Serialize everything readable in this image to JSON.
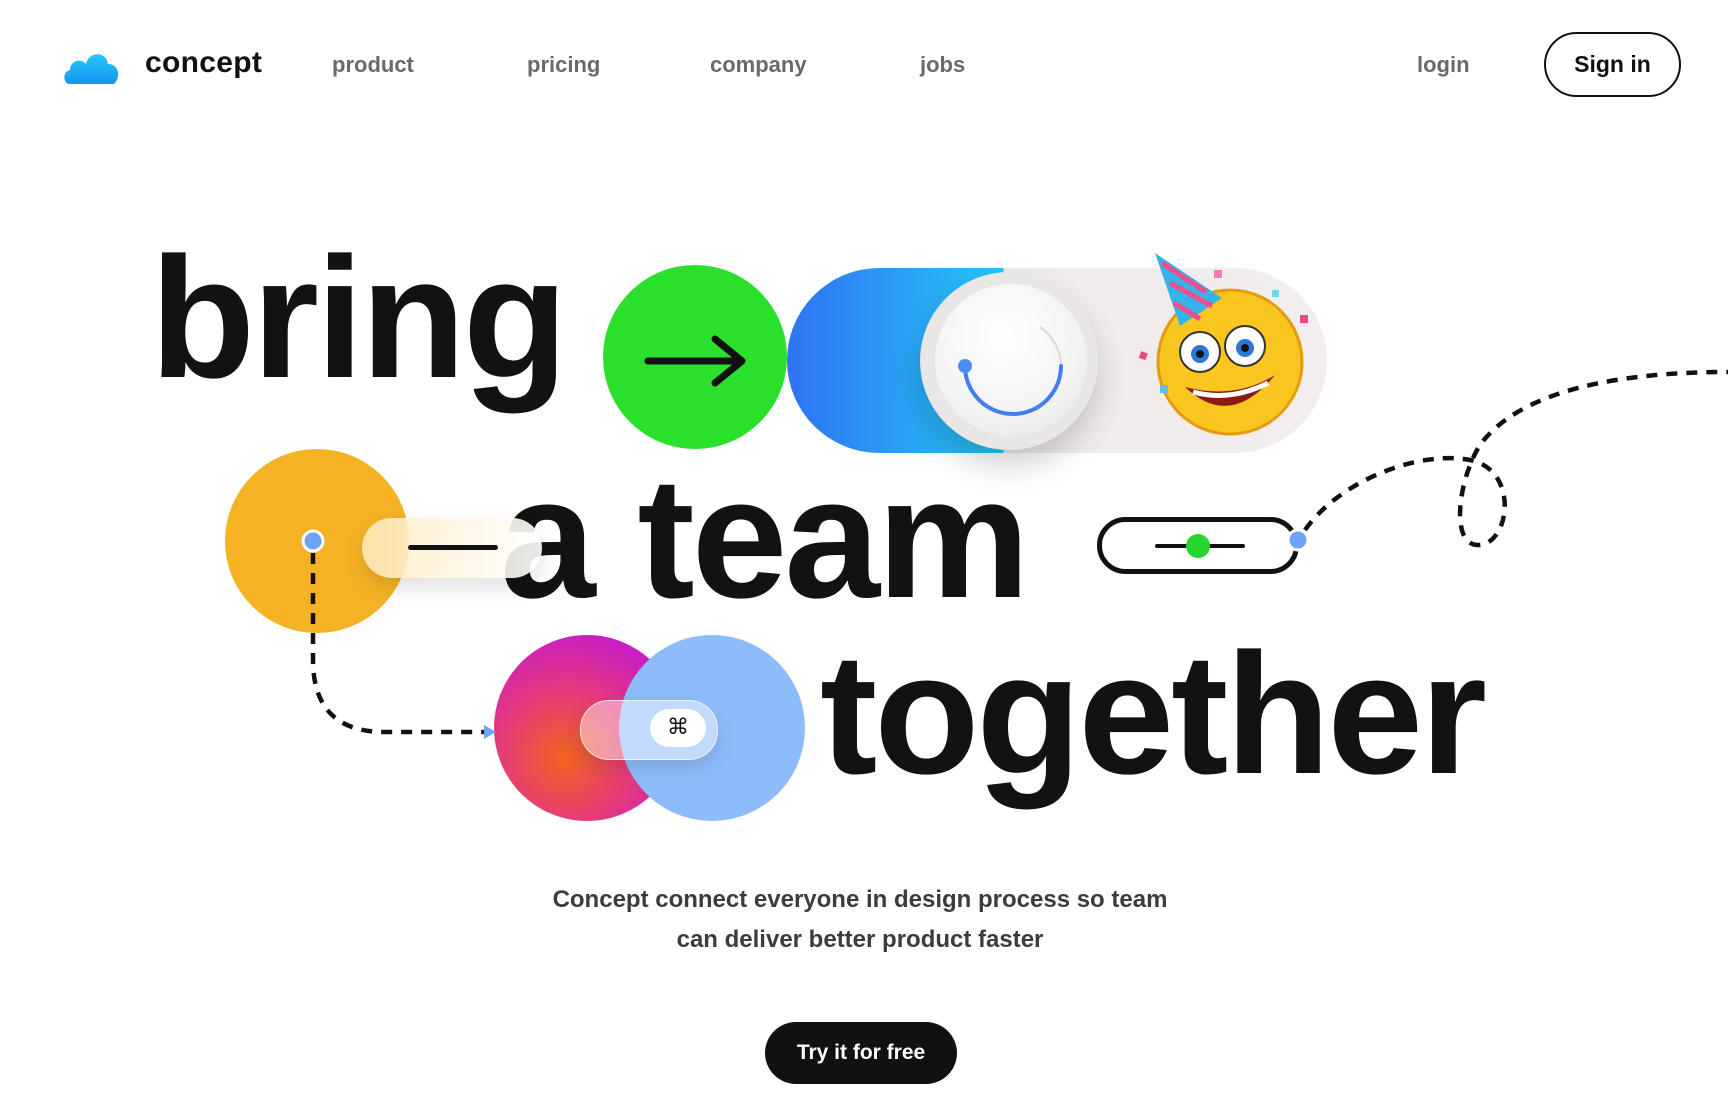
{
  "header": {
    "brand": "concept",
    "nav": [
      "product",
      "pricing",
      "company",
      "jobs"
    ],
    "login": "login",
    "sign_in": "Sign in"
  },
  "hero": {
    "line1": "bring",
    "line2": "a team",
    "line3": "together",
    "command_key": "⌘",
    "subtitle_line1": "Concept connect everyone in design process so team",
    "subtitle_line2": "can deliver better product faster",
    "cta": "Try it for free"
  },
  "colors": {
    "accent_green": "#2ae02a",
    "accent_yellow": "#f5b224",
    "accent_blue": "#8ebcfb",
    "text_dark": "#121212"
  },
  "icons": [
    "cloud-logo-icon",
    "arrow-right-icon",
    "party-emoji-icon",
    "command-key-icon"
  ]
}
